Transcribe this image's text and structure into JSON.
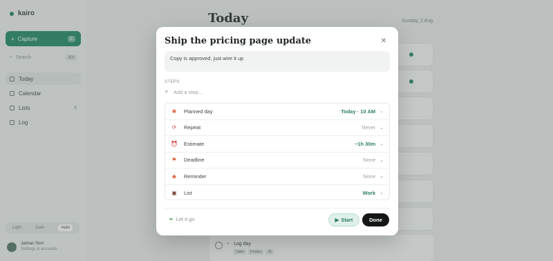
{
  "sidebar": {
    "brand": "kairo",
    "capture_label": "Capture",
    "capture_shortcut": "C",
    "search_placeholder": "Search",
    "search_shortcut": "⌘K",
    "items": [
      {
        "label": "Today",
        "count": ""
      },
      {
        "label": "Calendar",
        "count": ""
      },
      {
        "label": "Lists",
        "count": "6"
      },
      {
        "label": "Log",
        "count": ""
      }
    ],
    "theme": [
      "Light",
      "Dark",
      "Auto"
    ],
    "user": {
      "name": "Jaiman Soni",
      "sub": "Settings & accounts"
    }
  },
  "main": {
    "title": "Today",
    "date": "Sunday, 2 Aug",
    "bg_task": {
      "title": "Log day",
      "tags": [
        "Calm",
        "5 hours",
        "1h"
      ]
    }
  },
  "modal": {
    "title": "Ship the pricing page update",
    "notes": "Copy is approved, just wire it up",
    "steps_label": "STEPS",
    "add_step_placeholder": "Add a step...",
    "properties": [
      {
        "label": "Planned day",
        "value": "Today · 10 AM",
        "set": true,
        "icon": "sun-icon",
        "glyph": "✺",
        "color": "#e0623a"
      },
      {
        "label": "Repeat",
        "value": "Never",
        "set": false,
        "icon": "repeat-icon",
        "glyph": "⟳",
        "color": "#d9534f"
      },
      {
        "label": "Estimate",
        "value": "~1h 30m",
        "set": true,
        "icon": "alarm-clock-icon",
        "glyph": "⏰",
        "color": "#e07a3a"
      },
      {
        "label": "Deadline",
        "value": "None",
        "set": false,
        "icon": "flag-icon",
        "glyph": "⚑",
        "color": "#e0623a"
      },
      {
        "label": "Reminder",
        "value": "None",
        "set": false,
        "icon": "bell-icon",
        "glyph": "◆",
        "color": "#e06a4a"
      },
      {
        "label": "List",
        "value": "Work",
        "set": true,
        "icon": "briefcase-icon",
        "glyph": "▣",
        "color": "#7a4a3a"
      }
    ],
    "let_go_label": "Let it go",
    "start_label": "Start",
    "done_label": "Done"
  },
  "colors": {
    "accent": "#2e8f6f",
    "accent_text": "#2e7d63",
    "done_bg": "#151716"
  }
}
